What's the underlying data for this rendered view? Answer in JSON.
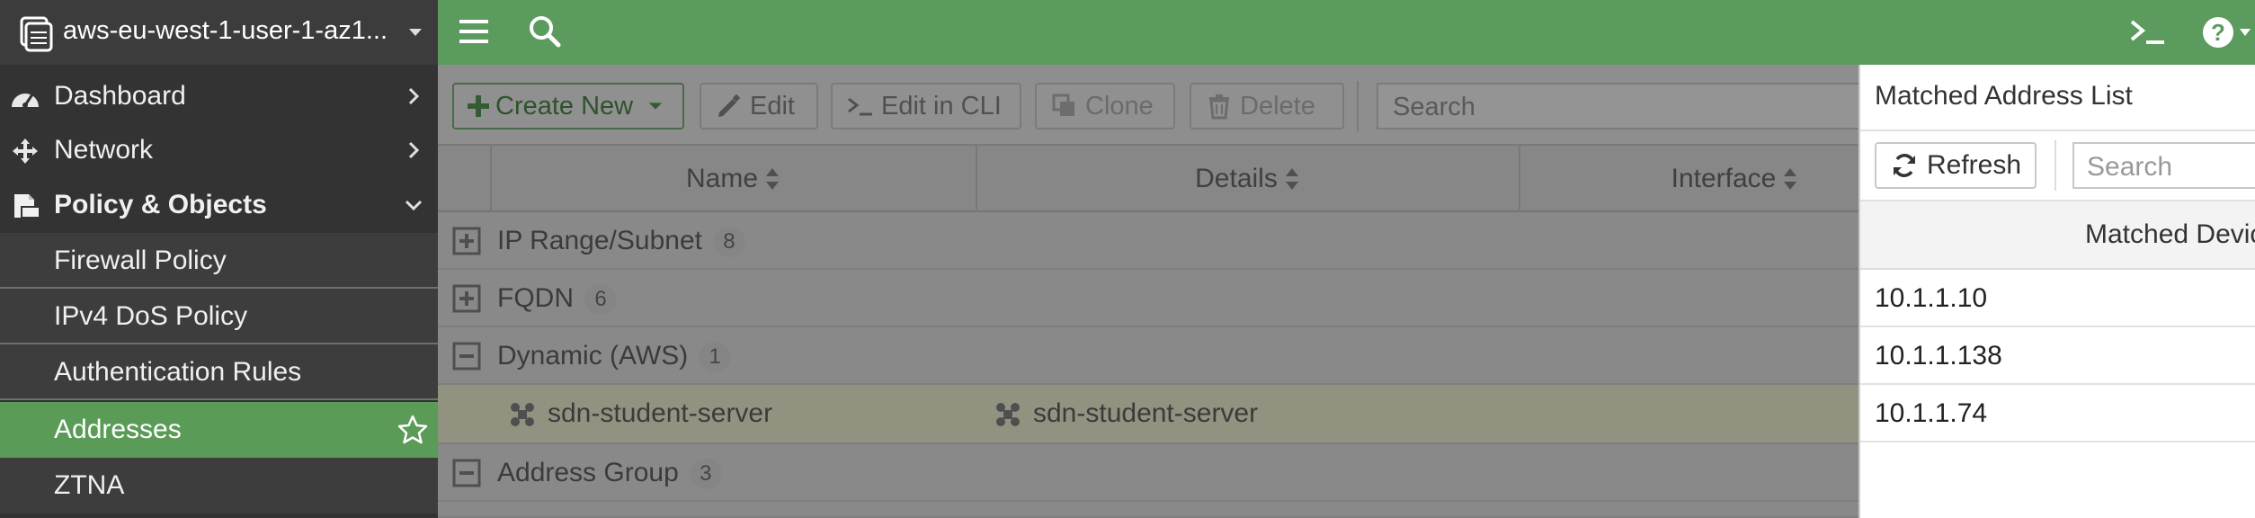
{
  "sidebar": {
    "vdom_title": "aws-eu-west-1-user-1-az1...",
    "items": [
      {
        "label": "Dashboard",
        "icon": "dashboard-icon"
      },
      {
        "label": "Network",
        "icon": "network-icon"
      },
      {
        "label": "Policy & Objects",
        "icon": "policy-objects-icon",
        "expanded": true
      }
    ],
    "subitems": [
      {
        "label": "Firewall Policy"
      },
      {
        "label": "IPv4 DoS Policy"
      },
      {
        "label": "Authentication Rules"
      },
      {
        "label": "Addresses",
        "active": true
      },
      {
        "label": "ZTNA"
      }
    ]
  },
  "topbar": {
    "icons": [
      "menu-icon",
      "search-icon",
      "cli-console-icon",
      "help-icon"
    ],
    "accent_color": "#5b9b5e"
  },
  "toolbar": {
    "create_new_label": "Create New",
    "edit_label": "Edit",
    "edit_cli_label": "Edit in CLI",
    "clone_label": "Clone",
    "delete_label": "Delete",
    "search_placeholder": "Search"
  },
  "table": {
    "columns": [
      "Name",
      "Details",
      "Interface"
    ],
    "groups": [
      {
        "label": "IP Range/Subnet",
        "count": "8",
        "expanded": false
      },
      {
        "label": "FQDN",
        "count": "6",
        "expanded": false
      },
      {
        "label": "Dynamic (AWS)",
        "count": "1",
        "expanded": true
      },
      {
        "label": "Address Group",
        "count": "3",
        "expanded": true
      }
    ],
    "highlighted_row": {
      "name": "sdn-student-server",
      "details": "sdn-student-server"
    }
  },
  "panel": {
    "title": "Matched Address List",
    "refresh_label": "Refresh",
    "search_placeholder": "Search",
    "column_header": "Matched Devic",
    "addresses": [
      "10.1.1.10",
      "10.1.1.138",
      "10.1.1.74"
    ]
  }
}
